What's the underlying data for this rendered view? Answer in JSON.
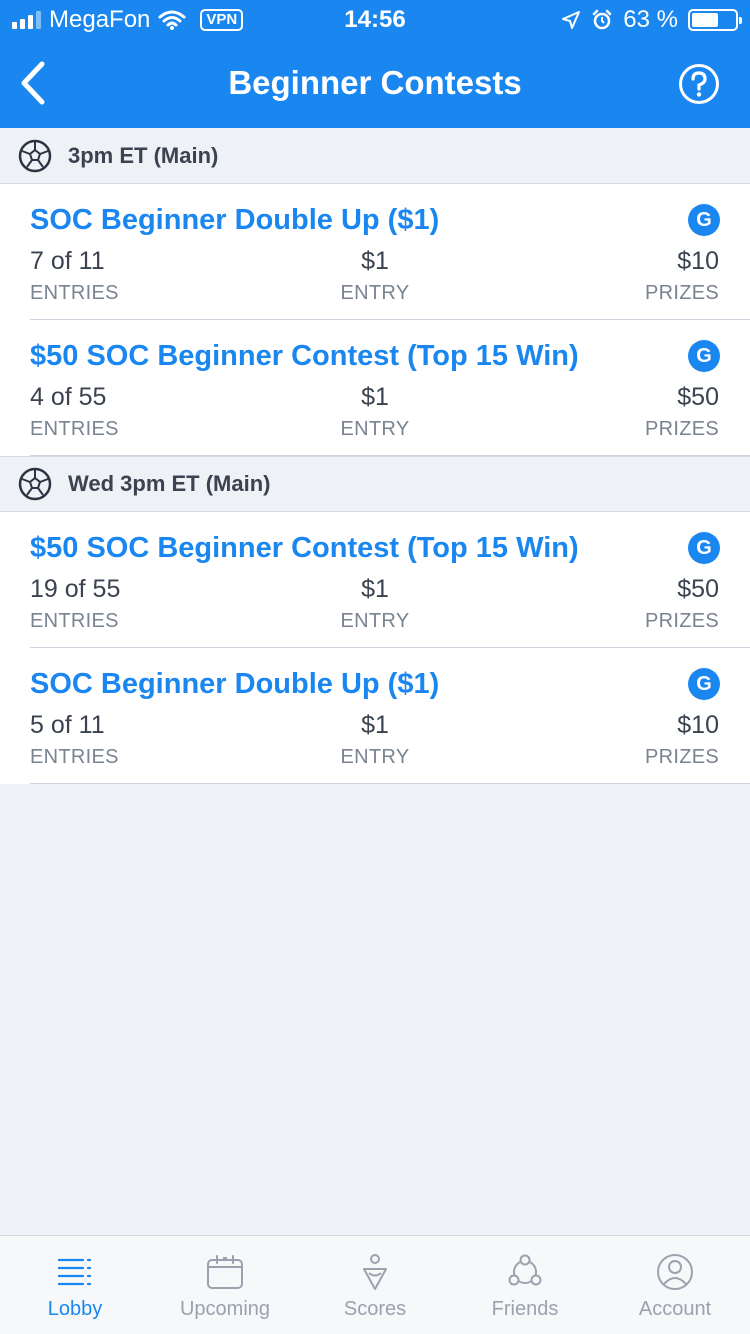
{
  "status_bar": {
    "carrier": "MegaFon",
    "vpn": "VPN",
    "time": "14:56",
    "battery": "63 %"
  },
  "nav": {
    "title": "Beginner Contests"
  },
  "sections": [
    {
      "header": "3pm ET (Main)",
      "contests": [
        {
          "name": "SOC Beginner Double Up ($1)",
          "badge": "G",
          "entries": "7 of 11",
          "entries_label": "ENTRIES",
          "entry": "$1",
          "entry_label": "ENTRY",
          "prizes": "$10",
          "prizes_label": "PRIZES"
        },
        {
          "name": "$50 SOC Beginner Contest (Top 15 Win)",
          "badge": "G",
          "entries": "4 of 55",
          "entries_label": "ENTRIES",
          "entry": "$1",
          "entry_label": "ENTRY",
          "prizes": "$50",
          "prizes_label": "PRIZES"
        }
      ]
    },
    {
      "header": "Wed 3pm ET (Main)",
      "contests": [
        {
          "name": "$50 SOC Beginner Contest (Top 15 Win)",
          "badge": "G",
          "entries": "19 of 55",
          "entries_label": "ENTRIES",
          "entry": "$1",
          "entry_label": "ENTRY",
          "prizes": "$50",
          "prizes_label": "PRIZES"
        },
        {
          "name": "SOC Beginner Double Up ($1)",
          "badge": "G",
          "entries": "5 of 11",
          "entries_label": "ENTRIES",
          "entry": "$1",
          "entry_label": "ENTRY",
          "prizes": "$10",
          "prizes_label": "PRIZES"
        }
      ]
    }
  ],
  "tabs": [
    {
      "label": "Lobby",
      "icon": "lobby-icon",
      "active": true
    },
    {
      "label": "Upcoming",
      "icon": "calendar-icon",
      "active": false
    },
    {
      "label": "Scores",
      "icon": "scores-icon",
      "active": false
    },
    {
      "label": "Friends",
      "icon": "friends-icon",
      "active": false
    },
    {
      "label": "Account",
      "icon": "account-icon",
      "active": false
    }
  ],
  "colors": {
    "accent": "#1a87f0",
    "background": "#eef2f7",
    "inactive_tab": "#9aa2ad"
  }
}
